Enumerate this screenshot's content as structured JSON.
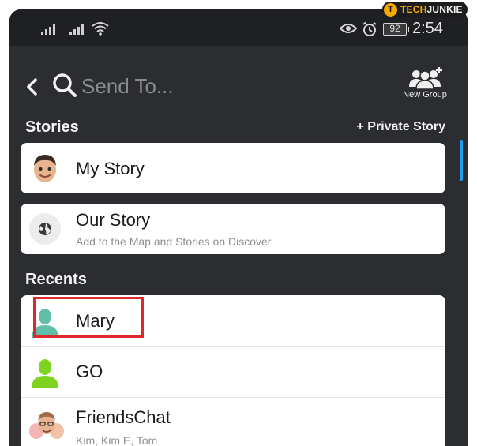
{
  "status_bar": {
    "time": "2:54",
    "battery": "92",
    "icons": [
      "signal-icon",
      "signal-icon",
      "wifi-icon",
      "eye-icon",
      "alarm-icon",
      "battery-icon"
    ]
  },
  "watermark": {
    "letter": "T",
    "brand_prefix": "TECH",
    "brand_suffix": "JUNKIE"
  },
  "header": {
    "search_placeholder": "Send To...",
    "new_group_label": "New Group"
  },
  "stories": {
    "title": "Stories",
    "private_story_label": "+ Private Story",
    "items": [
      {
        "name": "My Story"
      },
      {
        "name": "Our Story",
        "subtitle": "Add to the Map and Stories on Discover"
      }
    ]
  },
  "recents": {
    "title": "Recents",
    "items": [
      {
        "name": "Mary",
        "highlighted": true,
        "avatar_color": "#5fbfa8"
      },
      {
        "name": "GO",
        "avatar_color": "#7ed321"
      },
      {
        "name": "FriendsChat",
        "subtitle": "Kim, Kim E, Tom"
      }
    ]
  },
  "colors": {
    "background": "#2b2d31",
    "status_bar": "#1f2024",
    "highlight": "#e1262d",
    "scrollbar": "#1ea1f2"
  }
}
